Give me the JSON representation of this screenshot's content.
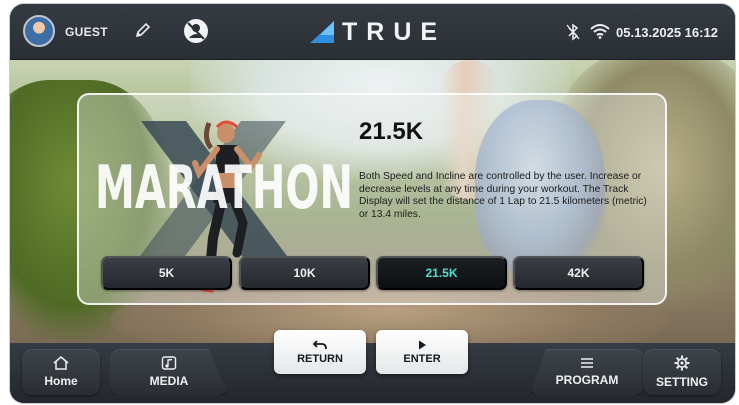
{
  "header": {
    "user_name": "GUEST",
    "brand": "TRUE",
    "datetime": "05.13.2025 16:12"
  },
  "program": {
    "hero_text": "MARATHON",
    "title": "21.5K",
    "description": "Both Speed and Incline are controlled by the user. Increase or decrease levels at any time during your workout. The Track Display will set the distance of 1 Lap to 21.5 kilometers (metric) or 13.4 miles.",
    "distances": [
      "5K",
      "10K",
      "21.5K",
      "42K"
    ],
    "selected": "21.5K"
  },
  "actions": {
    "return_label": "RETURN",
    "enter_label": "ENTER"
  },
  "nav": {
    "home_label": "Home",
    "media_label": "MEDIA",
    "program_label": "PROGRAM",
    "setting_label": "SETTING"
  },
  "colors": {
    "accent": "#48e0d2",
    "brand_blue": "#2f8fe0",
    "bar": "#2b3036"
  }
}
